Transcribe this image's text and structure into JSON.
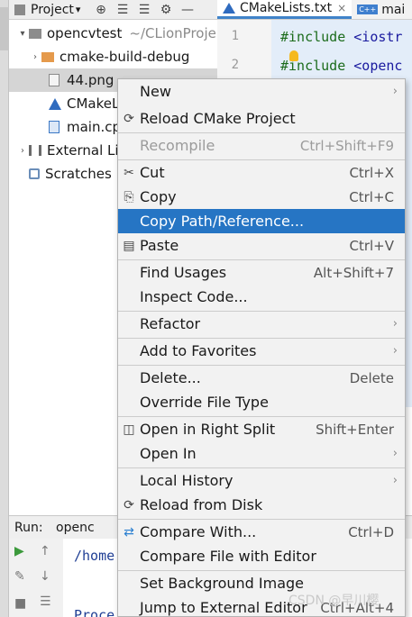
{
  "project_header": {
    "title": "Project",
    "dropdown_glyph": "▾",
    "tools": [
      "⊕",
      "☰",
      "☰",
      "⚙",
      "—"
    ]
  },
  "editor_tabs": [
    {
      "label": "CMakeLists.txt",
      "close": "×",
      "active": true
    },
    {
      "label": "mai",
      "icon": "C++"
    }
  ],
  "tree": {
    "root": {
      "label": "opencvtest",
      "path": "~/CLionProje"
    },
    "items": [
      {
        "label": "cmake-build-debug"
      },
      {
        "label": "44.png"
      },
      {
        "label": "CMakeL"
      },
      {
        "label": "main.cp"
      },
      {
        "label": "External Li"
      },
      {
        "label": "Scratches"
      }
    ]
  },
  "editor": {
    "line_numbers": [
      "1",
      "2"
    ],
    "lines": [
      {
        "kw": "#include",
        "rest": " <iostr"
      },
      {
        "kw": "#include",
        "rest": " <openc"
      }
    ]
  },
  "run_panel": {
    "label": "Run:",
    "tab": "openc",
    "output_path": "/home",
    "output_proc": "Proce"
  },
  "context_menu": {
    "items": [
      {
        "label": "New",
        "submenu": true
      },
      {
        "label": "Reload CMake Project",
        "icon": "⟳"
      },
      {
        "label": "Recompile",
        "shortcut": "Ctrl+Shift+F9",
        "disabled": true
      },
      {
        "label": "Cut",
        "shortcut": "Ctrl+X",
        "icon": "✂"
      },
      {
        "label": "Copy",
        "shortcut": "Ctrl+C",
        "icon": "⎘"
      },
      {
        "label": "Copy Path/Reference...",
        "highlighted": true
      },
      {
        "label": "Paste",
        "shortcut": "Ctrl+V",
        "icon": "📋"
      },
      {
        "label": "Find Usages",
        "shortcut": "Alt+Shift+7"
      },
      {
        "label": "Inspect Code..."
      },
      {
        "label": "Refactor",
        "submenu": true
      },
      {
        "label": "Add to Favorites",
        "submenu": true
      },
      {
        "label": "Delete...",
        "shortcut": "Delete"
      },
      {
        "label": "Override File Type"
      },
      {
        "label": "Open in Right Split",
        "shortcut": "Shift+Enter",
        "icon": "◫"
      },
      {
        "label": "Open In",
        "submenu": true
      },
      {
        "label": "Local History",
        "submenu": true
      },
      {
        "label": "Reload from Disk",
        "icon": "⟳"
      },
      {
        "label": "Compare With...",
        "shortcut": "Ctrl+D",
        "icon": "⇄"
      },
      {
        "label": "Compare File with Editor"
      },
      {
        "label": "Set Background Image"
      },
      {
        "label": "Jump to External Editor",
        "shortcut": "Ctrl+Alt+4"
      }
    ]
  },
  "watermark": "CSDN @早川樱",
  "colors": {
    "menu_highlight": "#2675c4",
    "selection_tree": "#d5d5d5",
    "code_bg": "#e3edf9",
    "cmake_icon": "#2f6bbf"
  }
}
